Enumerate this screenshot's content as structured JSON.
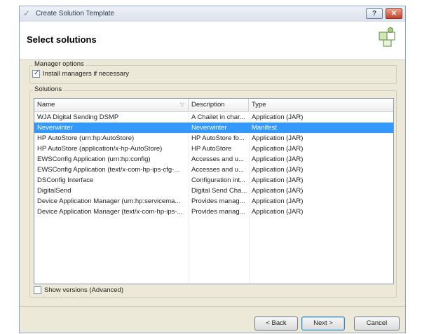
{
  "window": {
    "title": "Create Solution Template",
    "help_label": "?",
    "close_label": "✕"
  },
  "header": {
    "title": "Select solutions"
  },
  "manager_options": {
    "group_label": "Manager options",
    "install_managers_label": "Install managers if necessary",
    "install_managers_checked": true
  },
  "solutions": {
    "group_label": "Solutions",
    "columns": [
      "Name",
      "Description",
      "Type"
    ],
    "rows": [
      {
        "name": "WJA Digital Sending DSMP",
        "description": "A Chailet in char...",
        "type": "Application (JAR)"
      },
      {
        "name": "Neverwinter",
        "description": "Neverwinter",
        "type": "Manifest",
        "selected": true
      },
      {
        "name": "HP AutoStore (urn:hp:AutoStore)",
        "description": "HP AutoStore fo...",
        "type": "Application (JAR)"
      },
      {
        "name": "HP AutoStore (application/x-hp-AutoStore)",
        "description": "HP AutoStore",
        "type": "Application (JAR)"
      },
      {
        "name": "EWSConfig Application (urn:hp:config)",
        "description": "Accesses and u...",
        "type": "Application (JAR)"
      },
      {
        "name": "EWSConfig Application (text/x-com-hp-ips-cfg-...",
        "description": "Accesses and u...",
        "type": "Application (JAR)"
      },
      {
        "name": "DSConfig Interface",
        "description": "Configuration int...",
        "type": "Application (JAR)"
      },
      {
        "name": "DigitalSend",
        "description": "Digital Send Cha...",
        "type": "Application (JAR)"
      },
      {
        "name": "Device Application Manager (urn:hp:servicema...",
        "description": "Provides manag...",
        "type": "Application (JAR)"
      },
      {
        "name": "Device Application Manager (text/x-com-hp-ips-...",
        "description": "Provides manag...",
        "type": "Application (JAR)"
      }
    ],
    "show_versions_label": "Show versions (Advanced)",
    "show_versions_checked": false
  },
  "buttons": {
    "back": "< Back",
    "next": "Next >",
    "cancel": "Cancel"
  }
}
